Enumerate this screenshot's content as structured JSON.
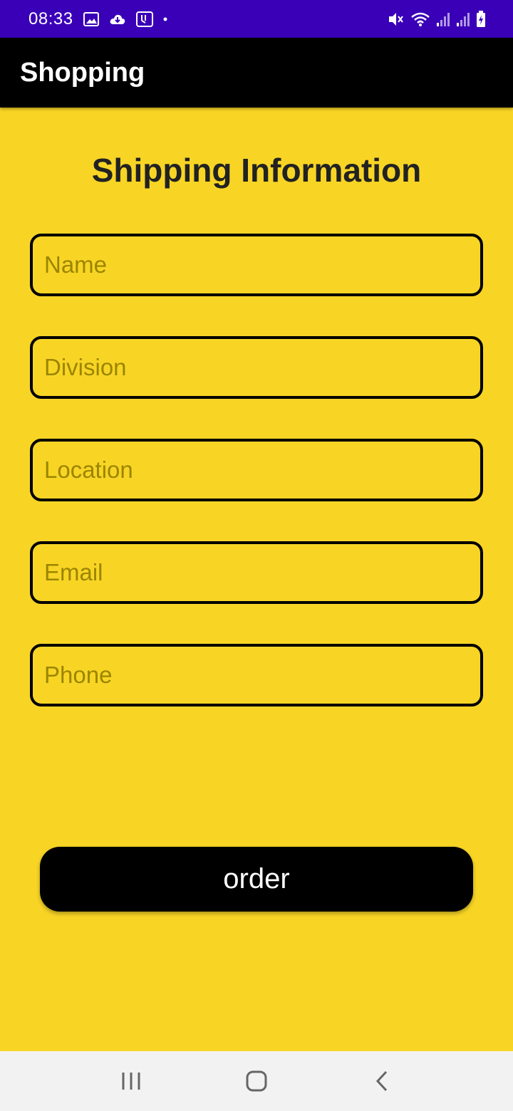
{
  "status_bar": {
    "time": "08:33",
    "left_icons": [
      "gallery-icon",
      "cloud-download-icon",
      "voicemail-icon",
      "dot-icon"
    ],
    "right_icons": [
      "mute-icon",
      "wifi-icon",
      "signal-icon",
      "signal-icon",
      "battery-charging-icon"
    ],
    "background": "#3A00B8"
  },
  "app_bar": {
    "title": "Shopping",
    "background": "#000000"
  },
  "form": {
    "title": "Shipping Information",
    "fields": [
      {
        "name": "name",
        "value": "",
        "placeholder": "Name"
      },
      {
        "name": "division",
        "value": "",
        "placeholder": "Division"
      },
      {
        "name": "location",
        "value": "",
        "placeholder": "Location"
      },
      {
        "name": "email",
        "value": "",
        "placeholder": "Email"
      },
      {
        "name": "phone",
        "value": "",
        "placeholder": "Phone"
      }
    ],
    "submit_label": "order",
    "background": "#F8D525"
  },
  "nav_bar": {
    "items": [
      "recent-apps-icon",
      "home-icon",
      "back-icon"
    ]
  }
}
